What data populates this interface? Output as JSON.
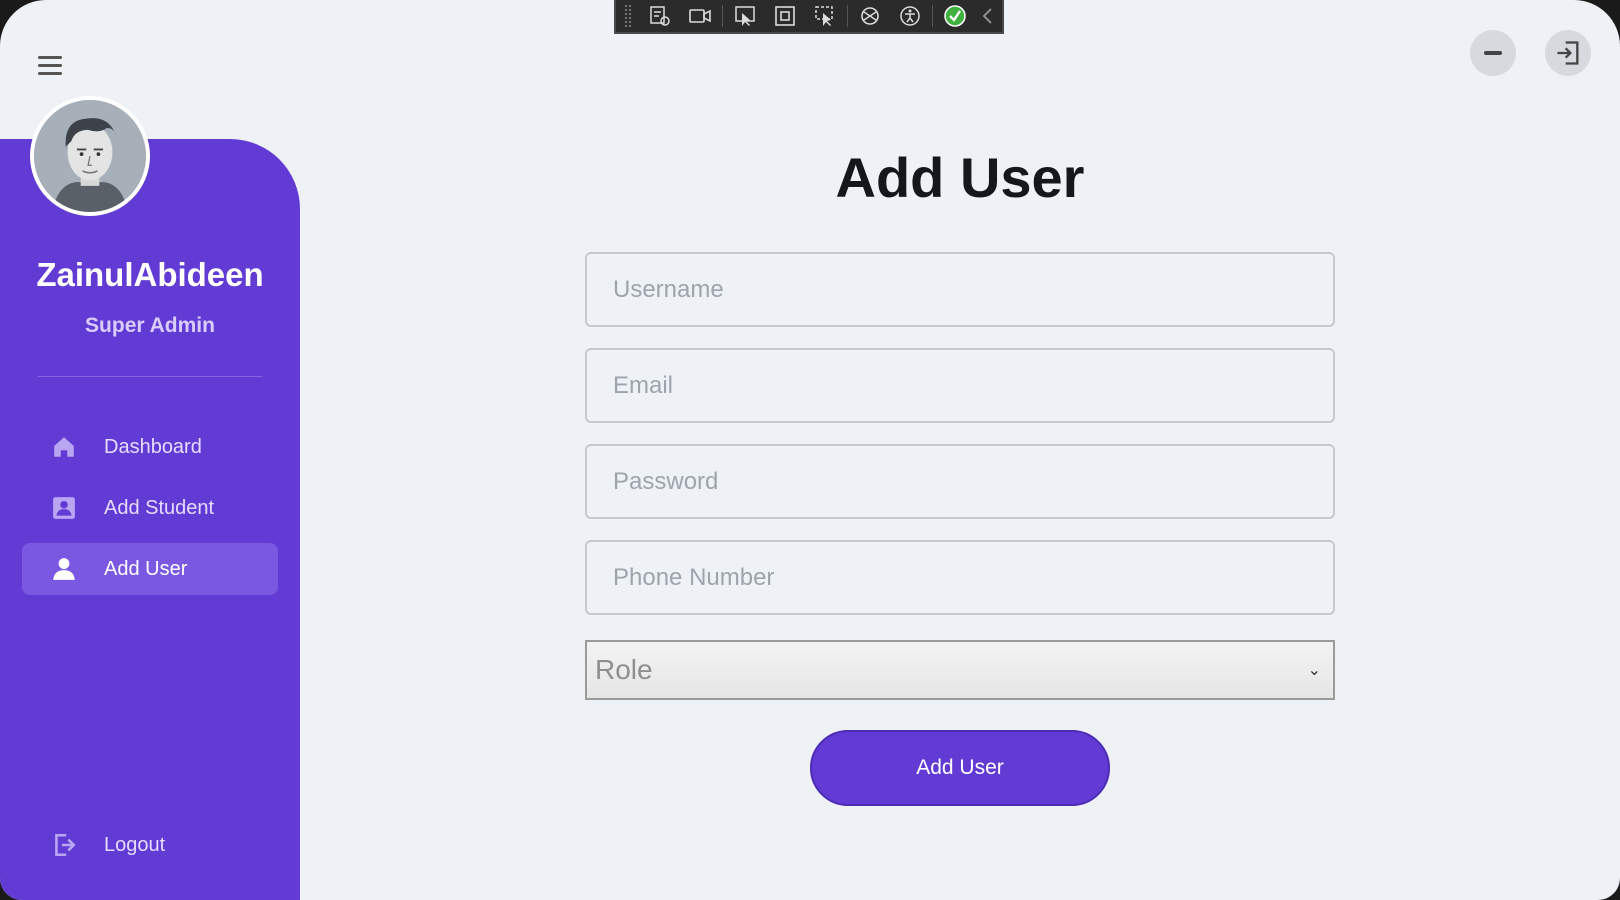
{
  "sidebar": {
    "user_name": "ZainulAbideen",
    "user_role": "Super Admin",
    "items": [
      {
        "label": "Dashboard",
        "icon": "home-icon",
        "active": false
      },
      {
        "label": "Add Student",
        "icon": "contact-card-icon",
        "active": false
      },
      {
        "label": "Add User",
        "icon": "person-icon",
        "active": true
      }
    ],
    "logout_label": "Logout"
  },
  "main": {
    "title": "Add User",
    "fields": {
      "username_placeholder": "Username",
      "email_placeholder": "Email",
      "password_placeholder": "Password",
      "phone_placeholder": "Phone Number"
    },
    "role_select": {
      "selected": "Role"
    },
    "submit_label": "Add User"
  },
  "colors": {
    "accent": "#623ad4",
    "background": "#eef2f7"
  },
  "toolbar_icons": [
    "select-element-icon",
    "record-icon",
    "pointer-icon",
    "layout-icon",
    "hit-test-icon",
    "hot-reload-icon",
    "accessibility-icon",
    "check-status-icon",
    "collapse-icon"
  ]
}
